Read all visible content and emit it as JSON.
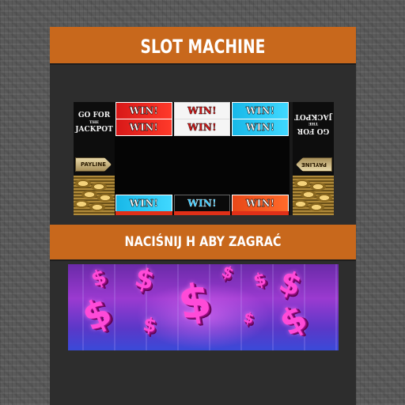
{
  "title": "SLOT MACHINE",
  "prompt": "NACIŚNIJ H ABY ZAGRAĆ",
  "machine": {
    "left_panel": {
      "jackpot_line1": "GO FOR",
      "jackpot_line2": "THE",
      "jackpot_line3": "JACKPOT",
      "payline": "PAYLINE"
    },
    "right_panel": {
      "jackpot_line1": "GO FOR",
      "jackpot_line2": "THE",
      "jackpot_line3": "JACKPOT",
      "payline": "PAYLINE"
    },
    "reel_rows": [
      {
        "tiles": [
          {
            "label": "WIN!",
            "style": "t-red"
          },
          {
            "label": "WIN!",
            "style": "t-white"
          },
          {
            "label": "WIN!",
            "style": "t-cyan"
          }
        ]
      },
      {
        "tiles": [
          {
            "label": "WIN!",
            "style": "t-red"
          },
          {
            "label": "WIN!",
            "style": "t-white"
          },
          {
            "label": "WIN!",
            "style": "t-cyan"
          }
        ]
      },
      {
        "tiles": [
          {
            "label": "WIN!",
            "style": "t-cyan"
          },
          {
            "label": "WIN!",
            "style": "t-black"
          },
          {
            "label": "WIN!",
            "style": "t-orange"
          }
        ]
      }
    ]
  },
  "colors": {
    "banner": "#c8681c",
    "panel": "#2d2d2d",
    "dollar": "#ff4ad8"
  },
  "promo_icon": "dollar-sign-icon"
}
